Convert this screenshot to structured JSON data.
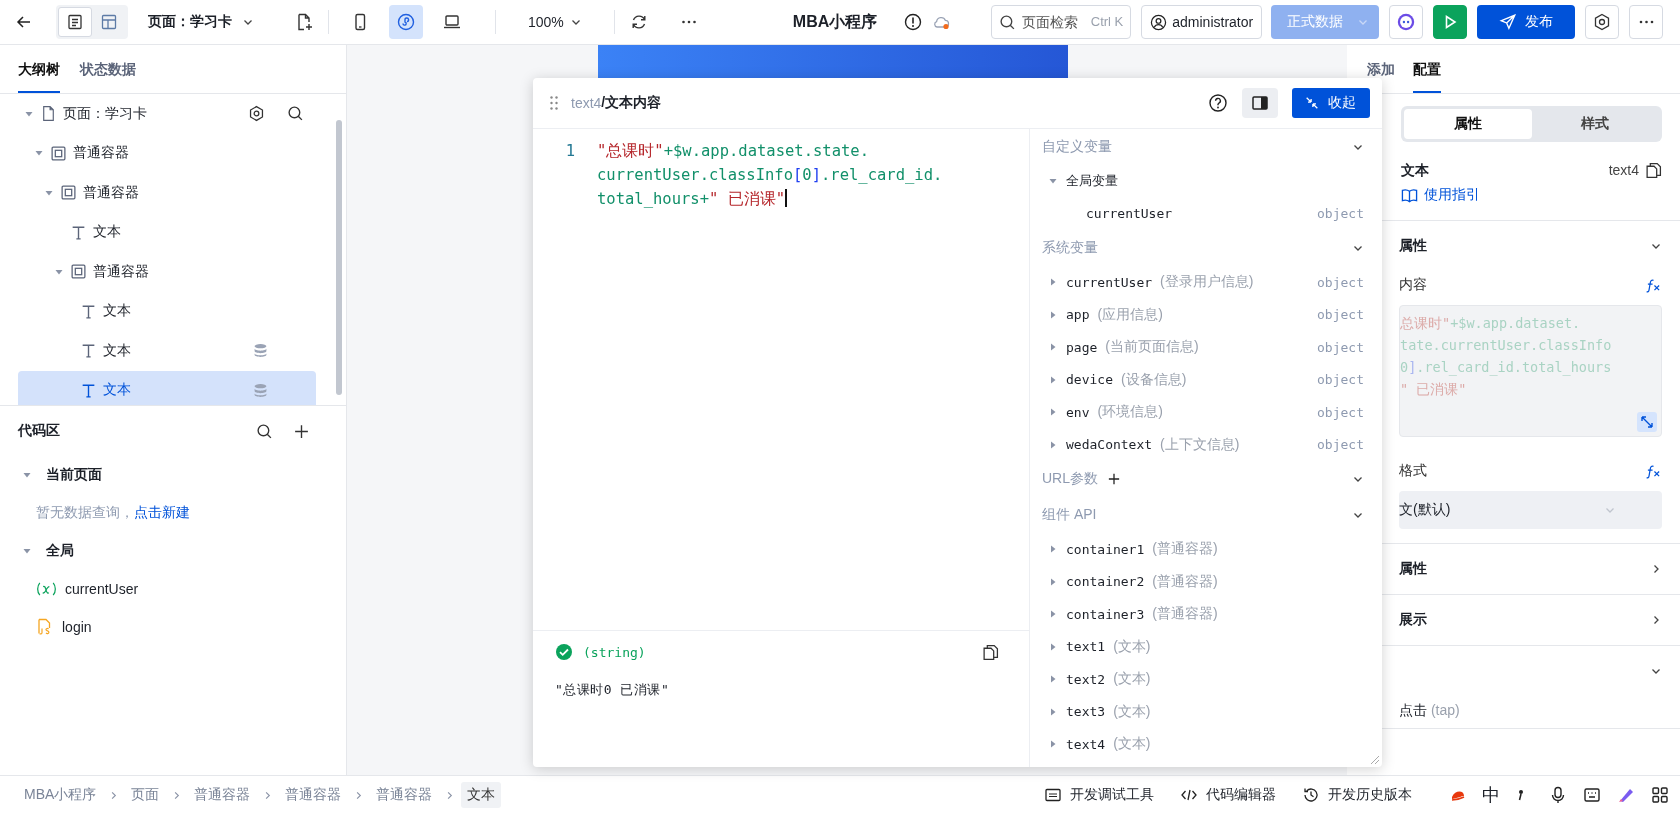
{
  "topbar": {
    "view_modes": [
      {
        "kind": "outline",
        "selected": true
      },
      {
        "kind": "layout",
        "selected": false
      }
    ],
    "page_selector": "页面：学习卡",
    "devices": [
      {
        "kind": "phone",
        "selected": false
      },
      {
        "kind": "miniprogram",
        "selected": true
      },
      {
        "kind": "desktop",
        "selected": false
      }
    ],
    "zoom": "100%",
    "app_title": "MBA小程序",
    "search": {
      "placeholder": "页面检索",
      "shortcut": "Ctrl K"
    },
    "user": "administrator",
    "data_source": {
      "label": "正式数据",
      "disabled": true
    },
    "publish": "发布"
  },
  "left_panel": {
    "tabs": [
      {
        "label": "大纲树",
        "selected": true
      },
      {
        "label": "状态数据",
        "selected": false
      }
    ],
    "tree": {
      "kind": "page",
      "label": "页面：学习卡",
      "expanded": true,
      "selected": false,
      "children": [
        {
          "kind": "container",
          "label": "普通容器",
          "expanded": true,
          "selected": false,
          "children": [
            {
              "kind": "container",
              "label": "普通容器",
              "expanded": true,
              "selected": false,
              "children": [
                {
                  "kind": "text",
                  "label": "文本",
                  "bound": false,
                  "selected": false
                },
                {
                  "kind": "container",
                  "label": "普通容器",
                  "expanded": true,
                  "selected": false,
                  "children": [
                    {
                      "kind": "text",
                      "label": "文本",
                      "bound": false,
                      "selected": false
                    },
                    {
                      "kind": "text",
                      "label": "文本",
                      "bound": true,
                      "selected": false
                    },
                    {
                      "kind": "text",
                      "label": "文本",
                      "bound": true,
                      "selected": true
                    }
                  ]
                }
              ]
            }
          ]
        }
      ]
    },
    "code_area": {
      "title": "代码区",
      "sections": [
        {
          "title": "当前页面",
          "expanded": true,
          "empty_text": "暂无数据查询，",
          "empty_link": "点击新建"
        },
        {
          "title": "全局",
          "expanded": true,
          "items": [
            {
              "kind": "variable",
              "label": "currentUser"
            },
            {
              "kind": "js",
              "label": "login"
            }
          ]
        }
      ]
    }
  },
  "editor": {
    "component_id": "text4",
    "title": "/文本内容",
    "collapse_button": "收起",
    "line_number": "1",
    "lines": [
      {
        "parts": [
          {
            "kind": "string",
            "text": "\"总课时\""
          },
          {
            "kind": "code",
            "text": "+$w.app.dataset.state."
          }
        ]
      },
      {
        "parts": [
          {
            "kind": "code",
            "text": "currentUser.classInfo"
          },
          {
            "kind": "bracket",
            "text": "["
          },
          {
            "kind": "code",
            "text": "0"
          },
          {
            "kind": "bracket",
            "text": "]"
          },
          {
            "kind": "code",
            "text": ".rel_card_id."
          }
        ]
      },
      {
        "parts": [
          {
            "kind": "code",
            "text": "total_hours+"
          },
          {
            "kind": "string",
            "text": "\" 已消课\""
          }
        ]
      }
    ],
    "result_type": "(string)",
    "result_ok": true,
    "result_value": "\"总课时0 已消课\"",
    "variables": [
      {
        "title": "自定义变量",
        "items": [
          {
            "name": "全局变量",
            "expanded": true,
            "children": [
              {
                "name": "currentUser",
                "type": "object"
              }
            ]
          }
        ]
      },
      {
        "title": "系统变量",
        "items": [
          {
            "name": "currentUser",
            "note": "(登录用户信息)",
            "type": "object",
            "expanded": false
          },
          {
            "name": "app",
            "note": "(应用信息)",
            "type": "object",
            "expanded": false
          },
          {
            "name": "page",
            "note": "(当前页面信息)",
            "type": "object",
            "expanded": false
          },
          {
            "name": "device",
            "note": "(设备信息)",
            "type": "object",
            "expanded": false
          },
          {
            "name": "env",
            "note": "(环境信息)",
            "type": "object",
            "expanded": false
          },
          {
            "name": "wedaContext",
            "note": "(上下文信息)",
            "type": "object",
            "expanded": false
          }
        ]
      },
      {
        "title": "URL参数",
        "addable": true
      },
      {
        "title": "组件 API",
        "items": [
          {
            "name": "container1",
            "note": "(普通容器)",
            "expanded": false
          },
          {
            "name": "container2",
            "note": "(普通容器)",
            "expanded": false
          },
          {
            "name": "container3",
            "note": "(普通容器)",
            "expanded": false
          },
          {
            "name": "text1",
            "note": "(文本)",
            "expanded": false
          },
          {
            "name": "text2",
            "note": "(文本)",
            "expanded": false
          },
          {
            "name": "text3",
            "note": "(文本)",
            "expanded": false
          },
          {
            "name": "text4",
            "note": "(文本)",
            "expanded": false
          }
        ]
      }
    ]
  },
  "right_panel": {
    "tabs": [
      {
        "label": "添加",
        "selected": false
      },
      {
        "label": "配置",
        "selected": true
      }
    ],
    "segments": [
      {
        "label": "属性",
        "selected": true
      },
      {
        "label": "样式",
        "selected": false
      }
    ],
    "component": {
      "name": "文本",
      "id": "text4",
      "guide": "使用指引"
    },
    "sections": [
      {
        "title": "属性",
        "expanded": true,
        "fields": [
          {
            "kind": "code",
            "label": "内容",
            "lines": [
              {
                "parts": [
                  {
                    "kind": "string",
                    "text": "总课时\""
                  },
                  {
                    "kind": "code",
                    "text": "+$w.app.dataset."
                  }
                ]
              },
              {
                "parts": [
                  {
                    "kind": "code",
                    "text": "tate.currentUser.classInfo"
                  }
                ]
              },
              {
                "parts": [
                  {
                    "kind": "code",
                    "text": "0"
                  },
                  {
                    "kind": "bracket",
                    "text": "]"
                  },
                  {
                    "kind": "code",
                    "text": ".rel_card_id.total_hours"
                  }
                ]
              },
              {
                "parts": [
                  {
                    "kind": "string",
                    "text": "\" 已消课\""
                  }
                ]
              }
            ]
          },
          {
            "kind": "select",
            "label": "格式",
            "value": "文(默认)"
          }
        ]
      },
      {
        "title": "属性",
        "expanded": false
      },
      {
        "title": "展示",
        "expanded": false
      },
      {
        "expanded": true,
        "items": [
          {
            "label": "点击",
            "note": "(tap)"
          }
        ]
      }
    ]
  },
  "bottom_bar": {
    "breadcrumbs": [
      {
        "label": "MBA小程序",
        "selected": false
      },
      {
        "label": "页面",
        "selected": false
      },
      {
        "label": "普通容器",
        "selected": false
      },
      {
        "label": "普通容器",
        "selected": false
      },
      {
        "label": "普通容器",
        "selected": false
      },
      {
        "label": "文本",
        "selected": true
      }
    ],
    "tools": [
      {
        "kind": "debug",
        "label": "开发调试工具"
      },
      {
        "kind": "code",
        "label": "代码编辑器"
      },
      {
        "kind": "history",
        "label": "开发历史版本"
      }
    ],
    "ime_mode": "中"
  }
}
